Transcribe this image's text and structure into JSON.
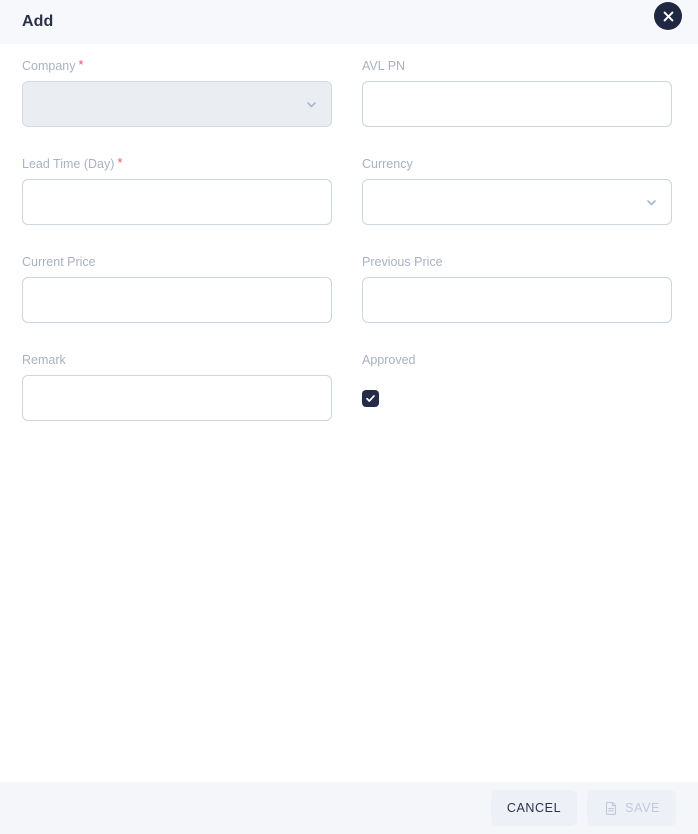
{
  "dialog": {
    "title": "Add",
    "close_icon": "close-x-icon"
  },
  "form": {
    "fields": [
      {
        "key": "company",
        "label": "Company",
        "required": true,
        "type": "select",
        "value": "",
        "placeholder": "",
        "state": "filled",
        "icon": "chevron-down-icon"
      },
      {
        "key": "avl_pn",
        "label": "AVL PN",
        "required": false,
        "type": "text",
        "value": "",
        "placeholder": ""
      },
      {
        "key": "lead_time_day",
        "label": "Lead Time (Day)",
        "required": true,
        "type": "text",
        "value": "",
        "placeholder": ""
      },
      {
        "key": "currency",
        "label": "Currency",
        "required": false,
        "type": "select",
        "value": "",
        "placeholder": "",
        "state": "default",
        "icon": "chevron-down-icon"
      },
      {
        "key": "current_price",
        "label": "Current Price",
        "required": false,
        "type": "text",
        "value": "",
        "placeholder": ""
      },
      {
        "key": "previous_price",
        "label": "Previous Price",
        "required": false,
        "type": "text",
        "value": "",
        "placeholder": ""
      },
      {
        "key": "remark",
        "label": "Remark",
        "required": false,
        "type": "text",
        "value": "",
        "placeholder": ""
      },
      {
        "key": "approved",
        "label": "Approved",
        "required": false,
        "type": "checkbox",
        "checked": true
      }
    ],
    "required_mark": "*"
  },
  "footer": {
    "cancel_label": "CANCEL",
    "save_label": "SAVE",
    "save_icon": "save-document-icon",
    "save_disabled": true
  },
  "colors": {
    "header_bg": "#f7f8fc",
    "footer_bg": "#f5f6fa",
    "title": "#2b3148",
    "label": "#a9b2c3",
    "required": "#e8546b",
    "input_border": "#ccd5e0",
    "select_filled_bg": "#eaeef2",
    "checkbox_checked": "#262b47",
    "close_bg": "#1f2742",
    "button_bg": "#eef0f7",
    "save_disabled_text": "#c2cada"
  }
}
